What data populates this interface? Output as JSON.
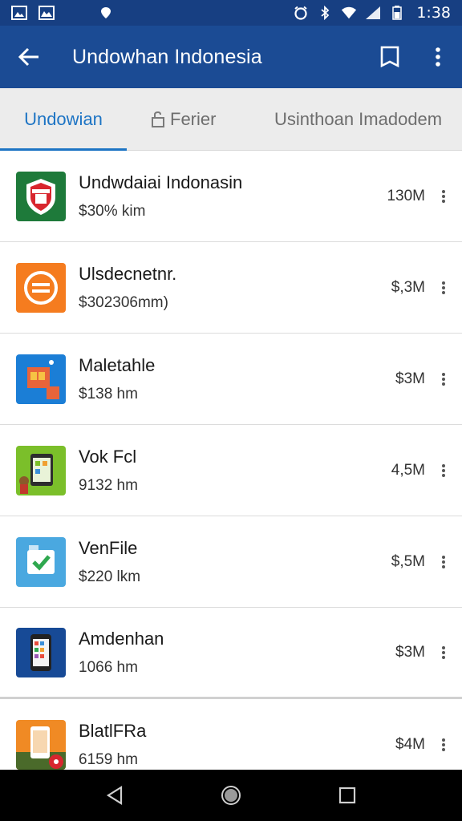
{
  "status_bar": {
    "time": "1:38"
  },
  "app_bar": {
    "title": "Undowhan Indonesia"
  },
  "tabs": [
    {
      "label": "Undowian",
      "active": true
    },
    {
      "label": "Ferier",
      "active": false
    },
    {
      "label": "Usinthoan Imadodem",
      "active": false
    }
  ],
  "items": [
    {
      "name": "Undwdaiai Indonasin",
      "sub": "$30% kim",
      "size": "130M",
      "icon": "shield-app-icon"
    },
    {
      "name": "Ulsdecnetnr.",
      "sub": "$302306mm)",
      "size": "$,3M",
      "icon": "orange-circle-app-icon"
    },
    {
      "name": "Maletahle",
      "sub": "$138 hm",
      "size": "$3M",
      "icon": "blue-card-app-icon"
    },
    {
      "name": "Vok Fcl",
      "sub": "9132 hm",
      "size": "4,5M",
      "icon": "phone-green-app-icon"
    },
    {
      "name": "VenFile",
      "sub": "$220 lkm",
      "size": "$,5M",
      "icon": "check-file-app-icon"
    },
    {
      "name": "Amdenhan",
      "sub": "1066 hm",
      "size": "$3M",
      "icon": "phone-blue-app-icon"
    },
    {
      "name": "BlatlFRa",
      "sub": "6159 hm",
      "size": "$4M",
      "icon": "orange-phone-app-icon"
    }
  ],
  "colors": {
    "status_bar": "#173f82",
    "app_bar": "#1b4b94",
    "accent": "#1d74c4",
    "tab_bg": "#ececec"
  }
}
